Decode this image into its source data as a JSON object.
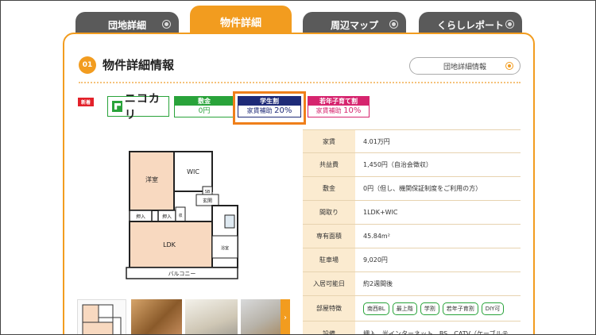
{
  "tabs": [
    {
      "label": "団地詳細",
      "active": false
    },
    {
      "label": "物件詳細",
      "active": true
    },
    {
      "label": "周辺マップ",
      "active": false
    },
    {
      "label": "くらしレポート",
      "active": false
    }
  ],
  "section": {
    "number": "01",
    "title": "物件詳細情報",
    "link_label": "団地詳細情報"
  },
  "badges": {
    "new": "新着",
    "nicokari": "ニコカリ",
    "shikikin": {
      "head": "敷金",
      "value": "0円"
    },
    "student": {
      "head": "学生割",
      "body_prefix": "家賃補助",
      "percent": "20%"
    },
    "young_family": {
      "head": "若年子育て割",
      "body_prefix": "家賃補助",
      "percent": "10%"
    }
  },
  "floorplan": {
    "rooms": {
      "washitsu": "洋室",
      "wic": "WIC",
      "sb": "SB",
      "genkan": "玄関",
      "oshiire1": "押入",
      "oshiire2": "押入",
      "toilet": "収",
      "ldk": "LDK",
      "bath": "浴室",
      "balcony": "バルコニー"
    }
  },
  "thumbs": {
    "next": "›"
  },
  "specs": [
    {
      "key": "家賃",
      "value": "4.01万円"
    },
    {
      "key": "共益費",
      "value": "1,450円（自治会徴収）"
    },
    {
      "key": "敷金",
      "value": "0円（但し、機関保証制度をご利用の方）"
    },
    {
      "key": "間取り",
      "value": "1LDK+WIC"
    },
    {
      "key": "専有面積",
      "value": "45.84m²"
    },
    {
      "key": "駐車場",
      "value": "9,020円"
    },
    {
      "key": "入居可能日",
      "value": "約2週間後"
    },
    {
      "key": "部屋特徴",
      "tags": [
        "南西BL",
        "最上階",
        "学割",
        "若年子育割",
        "DIY可"
      ]
    },
    {
      "key": "設備",
      "value": "押入、光インターネット、BS、CATV（ケーブルテ"
    }
  ],
  "colors": {
    "accent": "#f29c1f",
    "green": "#29a33a",
    "navy": "#1e2a78",
    "magenta": "#d6246e"
  }
}
